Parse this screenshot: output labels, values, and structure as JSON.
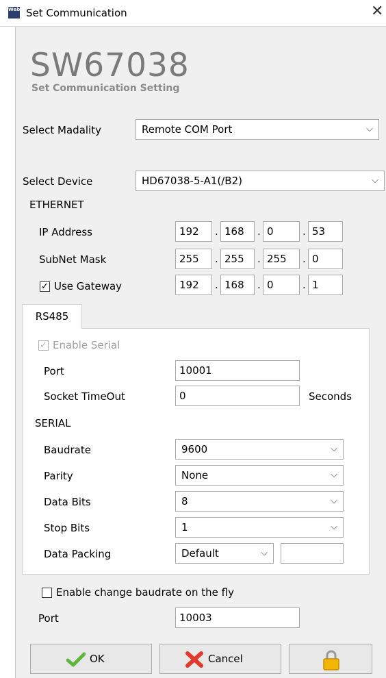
{
  "window": {
    "title": "Set Communication",
    "app_icon_text": "Web"
  },
  "header": {
    "brand": "SW67038",
    "subtitle": "Set Communication Setting"
  },
  "modality": {
    "label": "Select Madality",
    "value": "Remote COM Port"
  },
  "device": {
    "label": "Select Device",
    "value": "HD67038-5-A1(/B2)"
  },
  "ethernet": {
    "section_label": "ETHERNET",
    "ip_label": "IP Address",
    "ip": [
      "192",
      "168",
      "0",
      "53"
    ],
    "subnet_label": "SubNet Mask",
    "subnet": [
      "255",
      "255",
      "255",
      "0"
    ],
    "gateway_label": "Use Gateway",
    "gateway_checked": true,
    "gateway": [
      "192",
      "168",
      "0",
      "1"
    ]
  },
  "tab": {
    "label": "RS485"
  },
  "rs485": {
    "enable_serial_label": "Enable Serial",
    "enable_serial_checked": true,
    "port_label": "Port",
    "port_value": "10001",
    "timeout_label": "Socket TimeOut",
    "timeout_value": "0",
    "timeout_unit": "Seconds",
    "serial_section_label": "SERIAL",
    "baudrate_label": "Baudrate",
    "baudrate_value": "9600",
    "parity_label": "Parity",
    "parity_value": "None",
    "databits_label": "Data Bits",
    "databits_value": "8",
    "stopbits_label": "Stop Bits",
    "stopbits_value": "1",
    "packing_label": "Data Packing",
    "packing_value": "Default",
    "packing_extra": ""
  },
  "fly": {
    "checkbox_label": "Enable change baudrate on the fly",
    "checked": false,
    "port_label": "Port",
    "port_value": "10003"
  },
  "buttons": {
    "ok_label": "OK",
    "cancel_label": "Cancel"
  },
  "glyphs": {
    "check": "✓",
    "caret": "⌵",
    "close": "✕"
  }
}
